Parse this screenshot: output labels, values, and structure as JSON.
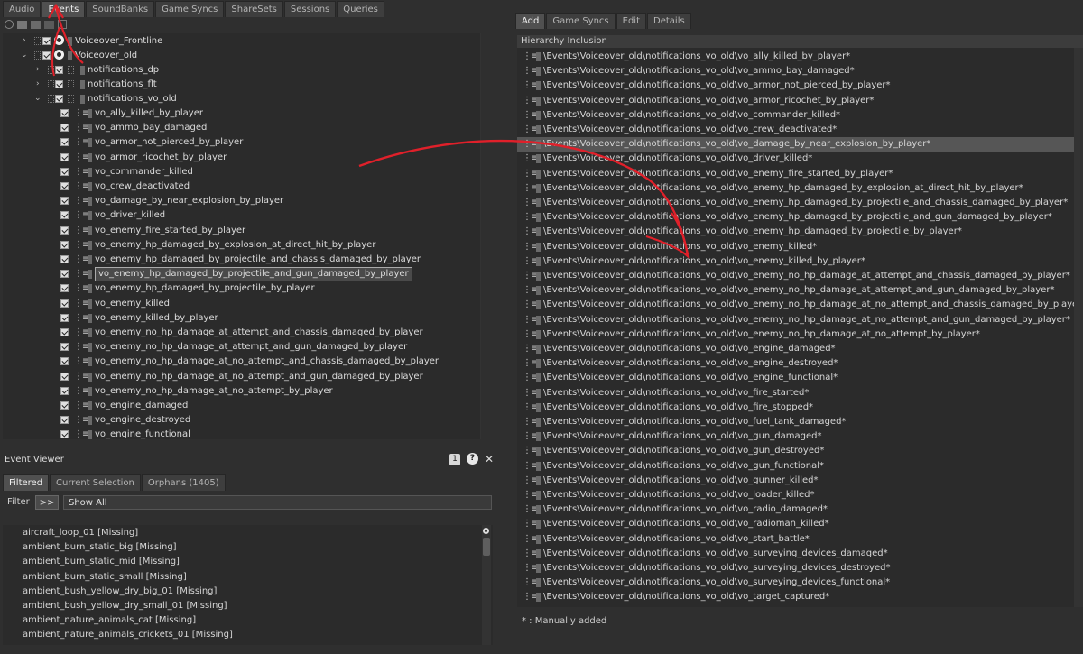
{
  "left_tabs": [
    "Audio",
    "Events",
    "SoundBanks",
    "Game Syncs",
    "ShareSets",
    "Sessions",
    "Queries"
  ],
  "left_active_tab": "Events",
  "tree": {
    "rows": [
      {
        "label": "Voiceover_Frontline",
        "expanded": false
      },
      {
        "label": "Voiceover_old",
        "expanded": true
      },
      {
        "label": "notifications_dp",
        "expanded": false
      },
      {
        "label": "notifications_flt",
        "expanded": false
      },
      {
        "label": "notifications_vo_old",
        "expanded": true
      }
    ],
    "events": [
      "vo_ally_killed_by_player",
      "vo_ammo_bay_damaged",
      "vo_armor_not_pierced_by_player",
      "vo_armor_ricochet_by_player",
      "vo_commander_killed",
      "vo_crew_deactivated",
      "vo_damage_by_near_explosion_by_player",
      "vo_driver_killed",
      "vo_enemy_fire_started_by_player",
      "vo_enemy_hp_damaged_by_explosion_at_direct_hit_by_player",
      "vo_enemy_hp_damaged_by_projectile_and_chassis_damaged_by_player",
      "vo_enemy_hp_damaged_by_projectile_and_gun_damaged_by_player",
      "vo_enemy_hp_damaged_by_projectile_by_player",
      "vo_enemy_killed",
      "vo_enemy_killed_by_player",
      "vo_enemy_no_hp_damage_at_attempt_and_chassis_damaged_by_player",
      "vo_enemy_no_hp_damage_at_attempt_and_gun_damaged_by_player",
      "vo_enemy_no_hp_damage_at_no_attempt_and_chassis_damaged_by_player",
      "vo_enemy_no_hp_damage_at_no_attempt_and_gun_damaged_by_player",
      "vo_enemy_no_hp_damage_at_no_attempt_by_player",
      "vo_engine_damaged",
      "vo_engine_destroyed",
      "vo_engine_functional"
    ],
    "selected_index": 11
  },
  "event_viewer": {
    "title": "Event Viewer",
    "badge": "1",
    "help": "?",
    "close": "✕",
    "tabs": [
      "Filtered",
      "Current Selection",
      "Orphans (1405)"
    ],
    "filter_label": "Filter",
    "filter_button": ">>",
    "filter_value": "Show All",
    "items": [
      "aircraft_loop_01 [Missing]",
      "ambient_burn_static_big [Missing]",
      "ambient_burn_static_mid [Missing]",
      "ambient_burn_static_small [Missing]",
      "ambient_bush_yellow_dry_big_01 [Missing]",
      "ambient_bush_yellow_dry_small_01 [Missing]",
      "ambient_nature_animals_cat [Missing]",
      "ambient_nature_animals_crickets_01 [Missing]"
    ]
  },
  "right_tabs": [
    "Add",
    "Game Syncs",
    "Edit",
    "Details"
  ],
  "right_active_tab": "Add",
  "hierarchy": {
    "header": "Hierarchy Inclusion",
    "selected_index": 6,
    "items": [
      "\\Events\\Voiceover_old\\notifications_vo_old\\vo_ally_killed_by_player*",
      "\\Events\\Voiceover_old\\notifications_vo_old\\vo_ammo_bay_damaged*",
      "\\Events\\Voiceover_old\\notifications_vo_old\\vo_armor_not_pierced_by_player*",
      "\\Events\\Voiceover_old\\notifications_vo_old\\vo_armor_ricochet_by_player*",
      "\\Events\\Voiceover_old\\notifications_vo_old\\vo_commander_killed*",
      "\\Events\\Voiceover_old\\notifications_vo_old\\vo_crew_deactivated*",
      "\\Events\\Voiceover_old\\notifications_vo_old\\vo_damage_by_near_explosion_by_player*",
      "\\Events\\Voiceover_old\\notifications_vo_old\\vo_driver_killed*",
      "\\Events\\Voiceover_old\\notifications_vo_old\\vo_enemy_fire_started_by_player*",
      "\\Events\\Voiceover_old\\notifications_vo_old\\vo_enemy_hp_damaged_by_explosion_at_direct_hit_by_player*",
      "\\Events\\Voiceover_old\\notifications_vo_old\\vo_enemy_hp_damaged_by_projectile_and_chassis_damaged_by_player*",
      "\\Events\\Voiceover_old\\notifications_vo_old\\vo_enemy_hp_damaged_by_projectile_and_gun_damaged_by_player*",
      "\\Events\\Voiceover_old\\notifications_vo_old\\vo_enemy_hp_damaged_by_projectile_by_player*",
      "\\Events\\Voiceover_old\\notifications_vo_old\\vo_enemy_killed*",
      "\\Events\\Voiceover_old\\notifications_vo_old\\vo_enemy_killed_by_player*",
      "\\Events\\Voiceover_old\\notifications_vo_old\\vo_enemy_no_hp_damage_at_attempt_and_chassis_damaged_by_player*",
      "\\Events\\Voiceover_old\\notifications_vo_old\\vo_enemy_no_hp_damage_at_attempt_and_gun_damaged_by_player*",
      "\\Events\\Voiceover_old\\notifications_vo_old\\vo_enemy_no_hp_damage_at_no_attempt_and_chassis_damaged_by_player*",
      "\\Events\\Voiceover_old\\notifications_vo_old\\vo_enemy_no_hp_damage_at_no_attempt_and_gun_damaged_by_player*",
      "\\Events\\Voiceover_old\\notifications_vo_old\\vo_enemy_no_hp_damage_at_no_attempt_by_player*",
      "\\Events\\Voiceover_old\\notifications_vo_old\\vo_engine_damaged*",
      "\\Events\\Voiceover_old\\notifications_vo_old\\vo_engine_destroyed*",
      "\\Events\\Voiceover_old\\notifications_vo_old\\vo_engine_functional*",
      "\\Events\\Voiceover_old\\notifications_vo_old\\vo_fire_started*",
      "\\Events\\Voiceover_old\\notifications_vo_old\\vo_fire_stopped*",
      "\\Events\\Voiceover_old\\notifications_vo_old\\vo_fuel_tank_damaged*",
      "\\Events\\Voiceover_old\\notifications_vo_old\\vo_gun_damaged*",
      "\\Events\\Voiceover_old\\notifications_vo_old\\vo_gun_destroyed*",
      "\\Events\\Voiceover_old\\notifications_vo_old\\vo_gun_functional*",
      "\\Events\\Voiceover_old\\notifications_vo_old\\vo_gunner_killed*",
      "\\Events\\Voiceover_old\\notifications_vo_old\\vo_loader_killed*",
      "\\Events\\Voiceover_old\\notifications_vo_old\\vo_radio_damaged*",
      "\\Events\\Voiceover_old\\notifications_vo_old\\vo_radioman_killed*",
      "\\Events\\Voiceover_old\\notifications_vo_old\\vo_start_battle*",
      "\\Events\\Voiceover_old\\notifications_vo_old\\vo_surveying_devices_damaged*",
      "\\Events\\Voiceover_old\\notifications_vo_old\\vo_surveying_devices_destroyed*",
      "\\Events\\Voiceover_old\\notifications_vo_old\\vo_surveying_devices_functional*",
      "\\Events\\Voiceover_old\\notifications_vo_old\\vo_target_captured*"
    ],
    "footnote": "* : Manually added"
  },
  "colors": {
    "annotation": "#e0202a",
    "selection": "#565656",
    "panel": "#2b2b2b"
  }
}
